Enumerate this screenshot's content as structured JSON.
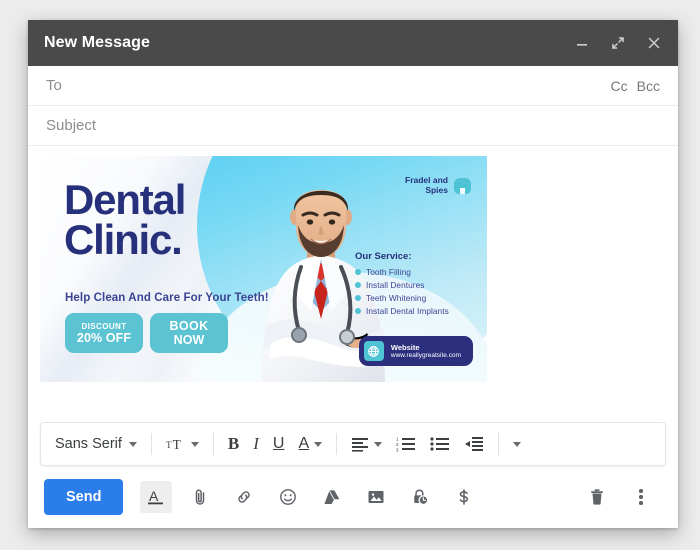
{
  "window": {
    "title": "New Message",
    "controls": [
      {
        "name": "minimize-button",
        "icon": "minimize-icon"
      },
      {
        "name": "expand-button",
        "icon": "expand-icon"
      },
      {
        "name": "close-button",
        "icon": "close-icon"
      }
    ]
  },
  "fields": {
    "to": {
      "label": "To",
      "value": "",
      "placeholder": "To"
    },
    "subject": {
      "label": "Subject",
      "value": "",
      "placeholder": "Subject"
    },
    "cc_label": "Cc",
    "bcc_label": "Bcc"
  },
  "banner": {
    "title_line1": "Dental",
    "title_line2": "Clinic.",
    "tagline": "Help Clean And Care For Your Teeth!",
    "cta_discount": {
      "line1": "DISCOUNT",
      "line2": "20% OFF"
    },
    "cta_book": {
      "line1": "BOOK",
      "line2": "NOW"
    },
    "logo": {
      "line1": "Fradel and",
      "line2": "Spies",
      "icon": "tooth-icon"
    },
    "services_title": "Our Service:",
    "services": [
      "Tooth Filling",
      "Install Dentures",
      "Teeth Whitening",
      "Install Dental Implants"
    ],
    "website": {
      "label": "Website",
      "url": "www.reallygreatsite.com",
      "icon": "globe-icon"
    },
    "colors": {
      "navy": "#27307a",
      "teal": "#4ec3d4",
      "cyan": "#3fc4f0",
      "pill_navy": "#2b2f7e"
    }
  },
  "format_toolbar": {
    "font_family": "Sans Serif",
    "items": [
      {
        "name": "font-family-dropdown",
        "label": "Sans Serif"
      },
      {
        "name": "font-size-button",
        "label": ""
      },
      {
        "name": "bold-button",
        "label": "B"
      },
      {
        "name": "italic-button",
        "label": "I"
      },
      {
        "name": "underline-button",
        "label": "U"
      },
      {
        "name": "text-color-button",
        "label": "A"
      },
      {
        "name": "align-button",
        "label": ""
      },
      {
        "name": "numbered-list-button",
        "label": ""
      },
      {
        "name": "bulleted-list-button",
        "label": ""
      },
      {
        "name": "indent-less-button",
        "label": ""
      },
      {
        "name": "more-format-options-button",
        "label": ""
      }
    ]
  },
  "bottom_bar": {
    "send_label": "Send",
    "send_color": "#2b7de9",
    "tools": [
      {
        "name": "formatting-options-button",
        "icon": "underlined-a-icon",
        "active": true
      },
      {
        "name": "attach-file-button",
        "icon": "paperclip-icon"
      },
      {
        "name": "insert-link-button",
        "icon": "link-icon"
      },
      {
        "name": "insert-emoji-button",
        "icon": "emoji-icon"
      },
      {
        "name": "insert-drive-file-button",
        "icon": "google-drive-icon"
      },
      {
        "name": "insert-photo-button",
        "icon": "image-icon"
      },
      {
        "name": "confidential-mode-button",
        "icon": "lock-clock-icon"
      },
      {
        "name": "insert-money-button",
        "icon": "dollar-icon"
      },
      {
        "name": "discard-draft-button",
        "icon": "trash-icon"
      },
      {
        "name": "more-options-button",
        "icon": "kebab-menu-icon"
      }
    ]
  }
}
